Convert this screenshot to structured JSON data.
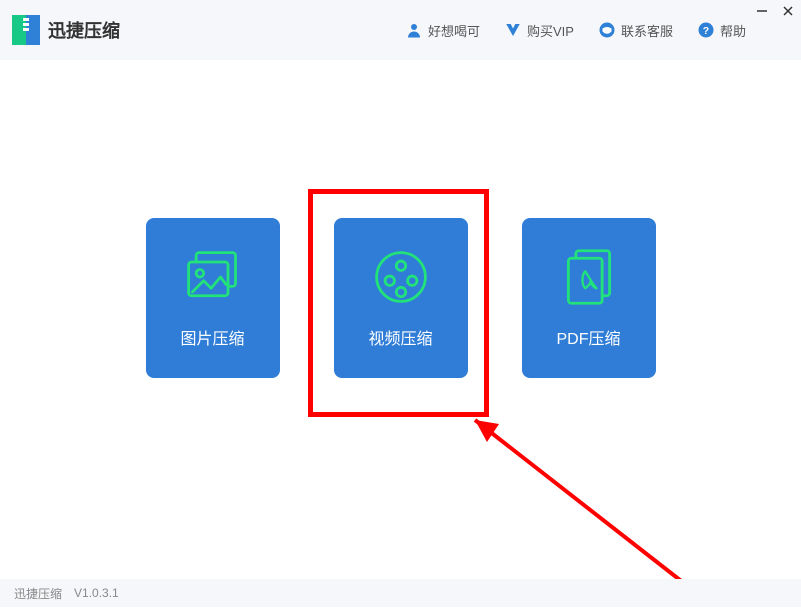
{
  "app": {
    "title": "迅捷压缩"
  },
  "topnav": {
    "user": "好想喝可",
    "vip": "购买VIP",
    "support": "联系客服",
    "help": "帮助"
  },
  "cards": {
    "image": "图片压缩",
    "video": "视频压缩",
    "pdf": "PDF压缩"
  },
  "status": {
    "name": "迅捷压缩",
    "version": "V1.0.3.1"
  },
  "highlight": {
    "target": "video"
  }
}
